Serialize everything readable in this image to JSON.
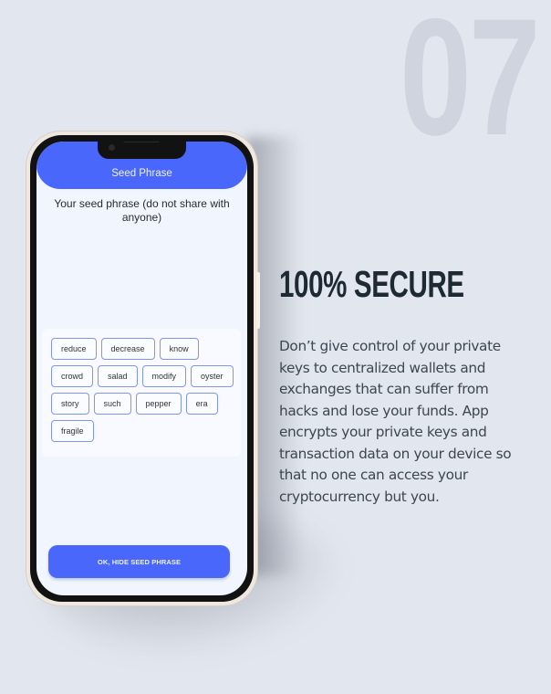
{
  "slide_number": "07",
  "app": {
    "header_title": "Seed Phrase",
    "subtitle": "Your seed phrase (do not share with anyone)",
    "seed_words": [
      "reduce",
      "decrease",
      "know",
      "crowd",
      "salad",
      "modify",
      "oyster",
      "story",
      "such",
      "pepper",
      "era",
      "fragile"
    ],
    "hide_button_label": "OK, HIDE SEED PHRASE"
  },
  "feature": {
    "heading": "100% SECURE",
    "description": "Don’t give control of your private keys to centralized wallets and exchanges that can suffer from hacks and lose your funds. App encrypts your private keys and transaction data on your device so that no one can access your cryptocurrency but you."
  },
  "colors": {
    "accent": "#4a67fb",
    "background": "#e2e6ee",
    "heading": "#1e2a33"
  }
}
